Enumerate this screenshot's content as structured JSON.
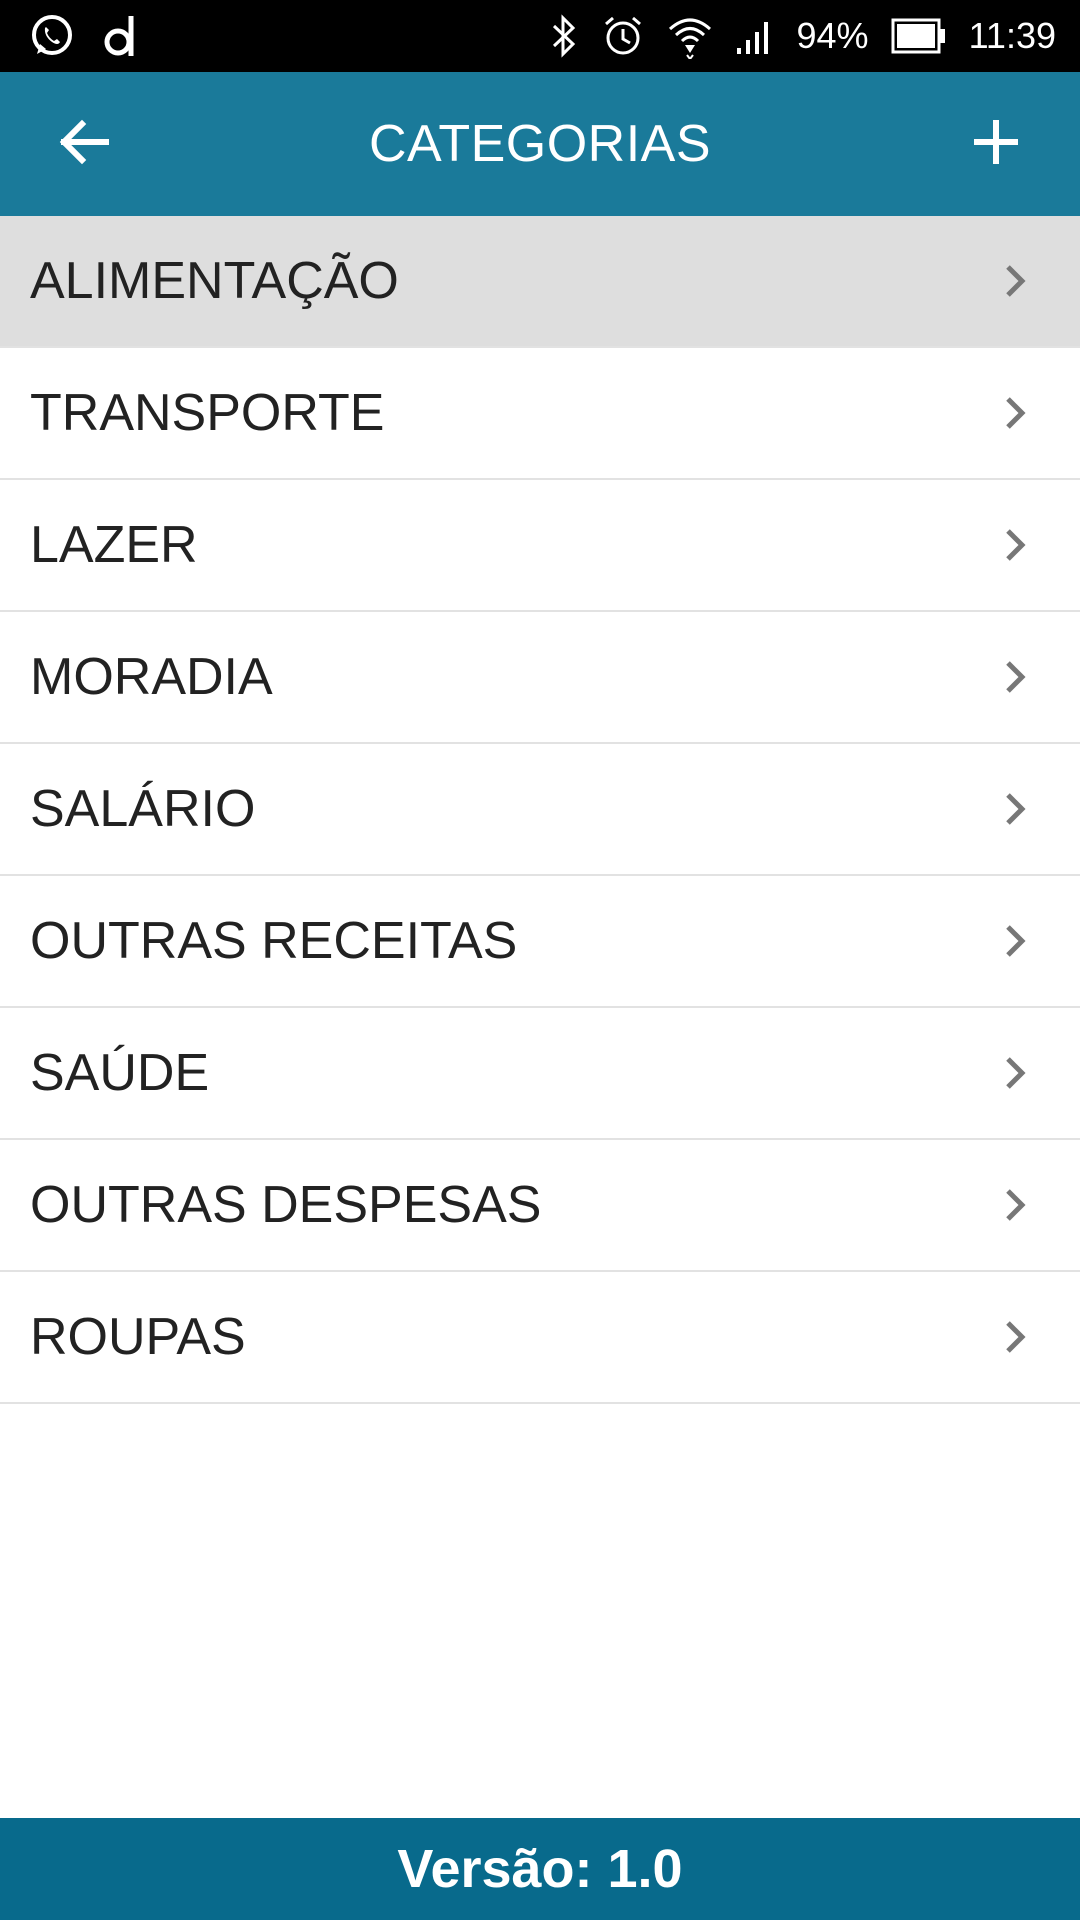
{
  "status_bar": {
    "icons_left": [
      "whatsapp-icon",
      "notification-d-icon"
    ],
    "icons_right": [
      "bluetooth-icon",
      "alarm-icon",
      "wifi-icon",
      "signal-icon"
    ],
    "battery": "94%",
    "time": "11:39"
  },
  "app_bar": {
    "title": "CATEGORIAS",
    "back_icon": "arrow-left-icon",
    "add_icon": "plus-icon"
  },
  "categories": [
    {
      "label": "ALIMENTAÇÃO",
      "selected": true
    },
    {
      "label": "TRANSPORTE",
      "selected": false
    },
    {
      "label": "LAZER",
      "selected": false
    },
    {
      "label": "MORADIA",
      "selected": false
    },
    {
      "label": "SALÁRIO",
      "selected": false
    },
    {
      "label": "OUTRAS RECEITAS",
      "selected": false
    },
    {
      "label": "SAÚDE",
      "selected": false
    },
    {
      "label": "OUTRAS DESPESAS",
      "selected": false
    },
    {
      "label": "ROUPAS",
      "selected": false
    }
  ],
  "footer": {
    "version_text": "Versão: 1.0"
  },
  "colors": {
    "app_bar": "#1a7a9a",
    "footer": "#086a8c",
    "selected_row": "#dedede",
    "chevron": "#777777"
  }
}
